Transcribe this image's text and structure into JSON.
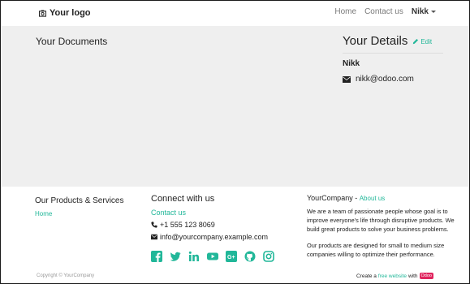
{
  "navbar": {
    "logo_label": "Your logo",
    "links": [
      "Home",
      "Contact us"
    ],
    "user": "Nikk"
  },
  "main": {
    "docs_title": "Your Documents",
    "details": {
      "title": "Your Details",
      "edit_label": "Edit",
      "name": "Nikk",
      "email": "nikk@odoo.com"
    }
  },
  "footer": {
    "products": {
      "title": "Our Products & Services",
      "home_link": "Home"
    },
    "connect": {
      "title": "Connect with us",
      "contact_link": "Contact us",
      "phone": "+1 555 123 8069",
      "email": "info@yourcompany.example.com",
      "social_icons": [
        "facebook-icon",
        "twitter-icon",
        "linkedin-icon",
        "youtube-icon",
        "google-plus-icon",
        "github-icon",
        "instagram-icon"
      ]
    },
    "about": {
      "company": "YourCompany",
      "separator": " - ",
      "about_link": "About us",
      "para1": "We are a team of passionate people whose goal is to improve everyone's life through disruptive products. We build great products to solve your business problems.",
      "para2": "Our products are designed for small to medium size companies willing to optimize their performance."
    },
    "copyright": "Copyright © YourCompany",
    "create": {
      "prefix": "Create a",
      "link": "free website",
      "with": "with",
      "badge": "Odoo"
    }
  },
  "colors": {
    "accent": "#21b799",
    "gray_bg": "#efefef",
    "badge": "#e0245e"
  }
}
